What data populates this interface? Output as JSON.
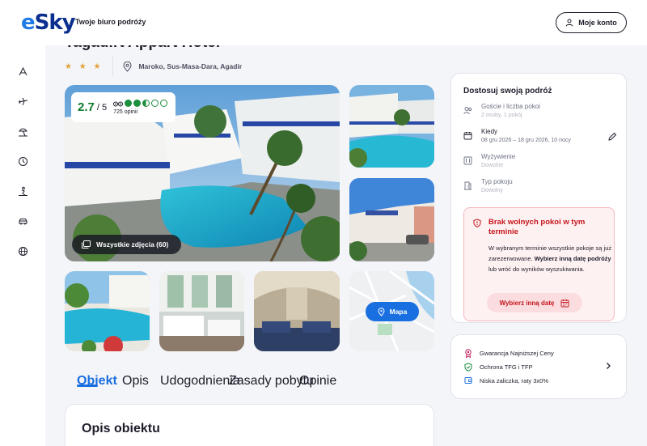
{
  "header": {
    "logo_prefix": "e",
    "logo_rest": "Sky",
    "tagline": "Twoje biuro podróży",
    "account_label": "Moje konto"
  },
  "rail": {
    "icons": [
      "hotel-icon",
      "plane-icon",
      "beach-icon",
      "clock-icon",
      "ski-icon",
      "car-icon",
      "globe-icon"
    ]
  },
  "hotel": {
    "title": "Tagadirt Appart Hotel",
    "stars": "★ ★ ★",
    "location": "Maroko, Sus-Masa-Dara, Agadir"
  },
  "rating": {
    "score": "2.7",
    "of": "/ 5",
    "bubbles": 2.5,
    "reviews": "725 opinii"
  },
  "gallery": {
    "all_photos_label": "Wszystkie zdjęcia (60)",
    "map_label": "Mapa"
  },
  "tabs": [
    "Obiekt",
    "Opis",
    "Udogodnienia",
    "Zasady pobytu",
    "Opinie"
  ],
  "description": {
    "title": "Opis obiektu"
  },
  "panel": {
    "title": "Dostosuj swoją podróż",
    "rows": [
      {
        "label": "Goście i liczba pokoi",
        "value": "2 osoby, 1 pokój",
        "icon": "guests-icon"
      },
      {
        "label": "Kiedy",
        "value": "08 gru 2026 – 18 gru 2026, 10 nocy",
        "icon": "calendar-icon"
      },
      {
        "label": "Wyżywienie",
        "value": "Dowolne",
        "icon": "meal-icon"
      },
      {
        "label": "Typ pokoju",
        "value": "Dowolny",
        "icon": "room-icon"
      }
    ],
    "alert": {
      "title": "Brak wolnych pokoi w tym terminie",
      "text_1": "W wybranym terminie wszystkie pokoje są już zarezerwowane.",
      "text_bold": "Wybierz inną datę podróży",
      "text_2": " lub wróć do wyników wyszukiwania.",
      "button": "Wybierz inną datę"
    }
  },
  "benefits": [
    {
      "label": "Gwarancja Najniższej Ceny",
      "icon": "medal-icon"
    },
    {
      "label": "Ochrona TFG i TFP",
      "icon": "shield-check-icon"
    },
    {
      "label": "Niska zaliczka, raty 3x0%",
      "icon": "wallet-icon"
    }
  ],
  "colors": {
    "brand_blue": "#0b2f8f",
    "accent_blue": "#1a6fe0",
    "rating_green": "#0e7a2b",
    "alert_red": "#c4151c",
    "star_gold": "#e2a23b"
  }
}
